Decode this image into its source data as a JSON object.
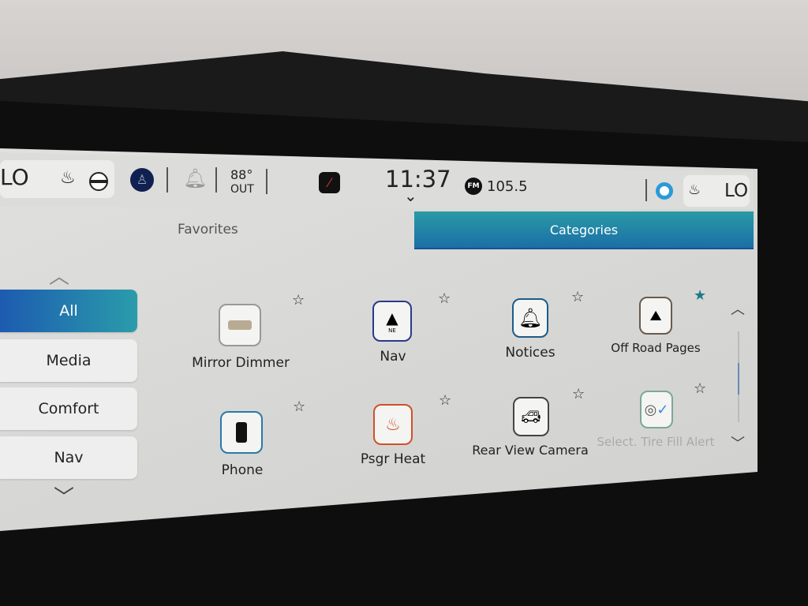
{
  "status_bar": {
    "left_climate": "LO",
    "temperature": "88°",
    "temperature_label": "OUT",
    "time": "11:37",
    "radio_band": "FM",
    "radio_station": "105.5",
    "right_climate": "LO"
  },
  "tabs": [
    {
      "label": "Favorites",
      "active": false
    },
    {
      "label": "Categories",
      "active": true
    }
  ],
  "sidebar": {
    "items": [
      {
        "label": "All",
        "active": true
      },
      {
        "label": "Media"
      },
      {
        "label": "Comfort"
      },
      {
        "label": "Nav"
      }
    ]
  },
  "apps": [
    {
      "label": "Mirror Dimmer",
      "icon": "mirror-icon",
      "favorite": false
    },
    {
      "label": "Nav",
      "icon": "compass-icon",
      "icon_text": "NE",
      "favorite": false
    },
    {
      "label": "Notices",
      "icon": "bell-icon",
      "favorite": false
    },
    {
      "label": "Off Road Pages",
      "icon": "mountain-icon",
      "favorite": true
    },
    {
      "label": "Phone",
      "icon": "phone-icon",
      "favorite": false
    },
    {
      "label": "Psgr Heat",
      "icon": "heated-seat-icon",
      "favorite": false
    },
    {
      "label": "Rear View Camera",
      "icon": "car-camera-icon",
      "favorite": false
    },
    {
      "label": "Select. Tire Fill Alert",
      "icon": "tire-check-icon",
      "favorite": false,
      "disabled": true
    }
  ],
  "colors": {
    "accent": "#2a9aa6",
    "active_sidebar": "#1d5bb0",
    "favorite_star": "#1a7a8a"
  }
}
